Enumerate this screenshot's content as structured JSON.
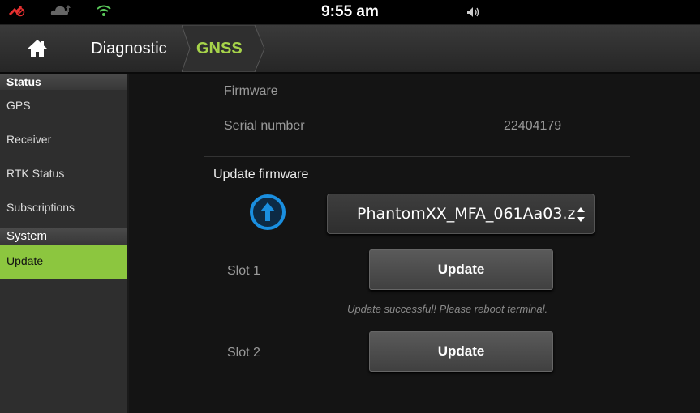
{
  "status_bar": {
    "time": "9:55 am",
    "icons": [
      "gps-off-icon",
      "cloud-icon",
      "wifi-icon",
      "volume-icon"
    ]
  },
  "breadcrumb": {
    "home_icon": "home-icon",
    "items": [
      "Diagnostic",
      "GNSS"
    ]
  },
  "sidebar": {
    "sections": [
      {
        "header": "Status",
        "items": [
          "GPS",
          "Receiver",
          "RTK Status",
          "Subscriptions"
        ]
      },
      {
        "header": "System",
        "items": [
          "Update"
        ]
      }
    ],
    "active_item": "Update"
  },
  "main": {
    "firmware_label": "Firmware",
    "serial_label": "Serial number",
    "serial_value": "22404179",
    "update_firmware_title": "Update firmware",
    "firmware_file": "PhantomXX_MFA_061Aa03.z",
    "slot1_label": "Slot 1",
    "slot1_button": "Update",
    "success_message": "Update successful! Please reboot terminal.",
    "slot2_label": "Slot 2",
    "slot2_button": "Update"
  },
  "colors": {
    "accent_green": "#8cc63f",
    "crumb_green": "#a6d34a",
    "update_icon_blue": "#1a8fe0"
  }
}
